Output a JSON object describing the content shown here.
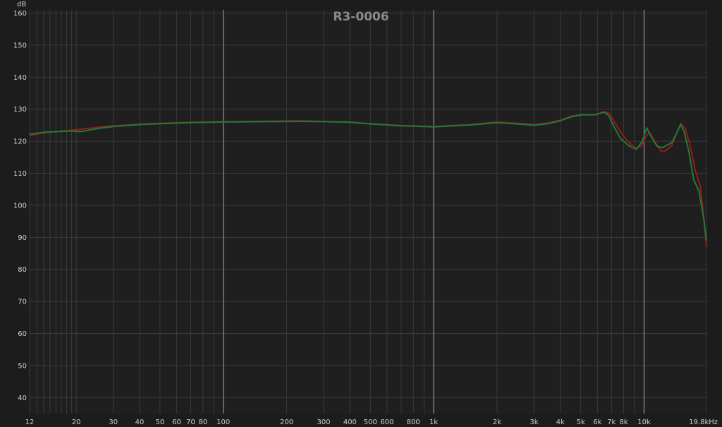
{
  "chart_data": {
    "type": "line",
    "title": "R3-0006",
    "ylabel": "dB",
    "xlabel": "",
    "x_scale": "log",
    "xlim": [
      12,
      19800
    ],
    "ylim": [
      35,
      161
    ],
    "grid": true,
    "y_ticks": [
      40,
      50,
      60,
      70,
      80,
      90,
      100,
      110,
      120,
      130,
      140,
      150,
      160
    ],
    "x_ticks": [
      {
        "v": 12,
        "label": "12"
      },
      {
        "v": 20,
        "label": "20"
      },
      {
        "v": 30,
        "label": "30"
      },
      {
        "v": 40,
        "label": "40"
      },
      {
        "v": 50,
        "label": "50"
      },
      {
        "v": 60,
        "label": "60"
      },
      {
        "v": 70,
        "label": "70"
      },
      {
        "v": 80,
        "label": "80"
      },
      {
        "v": 100,
        "label": "100"
      },
      {
        "v": 200,
        "label": "200"
      },
      {
        "v": 300,
        "label": "300"
      },
      {
        "v": 400,
        "label": "400"
      },
      {
        "v": 500,
        "label": "500"
      },
      {
        "v": 600,
        "label": "600"
      },
      {
        "v": 800,
        "label": "800"
      },
      {
        "v": 1000,
        "label": "1k"
      },
      {
        "v": 2000,
        "label": "2k"
      },
      {
        "v": 3000,
        "label": "3k"
      },
      {
        "v": 4000,
        "label": "4k"
      },
      {
        "v": 5000,
        "label": "5k"
      },
      {
        "v": 6000,
        "label": "6k"
      },
      {
        "v": 7000,
        "label": "7k"
      },
      {
        "v": 8000,
        "label": "8k"
      },
      {
        "v": 10000,
        "label": "10k"
      },
      {
        "v": 19800,
        "label": "19.8kHz"
      }
    ],
    "minor_grid_x": [
      12,
      13,
      14,
      15,
      16,
      17,
      18,
      19,
      20,
      30,
      40,
      50,
      60,
      70,
      80,
      90,
      200,
      300,
      400,
      500,
      600,
      700,
      800,
      900,
      2000,
      3000,
      4000,
      5000,
      6000,
      7000,
      8000,
      9000,
      19800
    ],
    "major_grid_x": [
      100,
      1000,
      10000
    ],
    "series": [
      {
        "color": "#9b1a16",
        "points": [
          [
            12,
            121.8
          ],
          [
            14,
            122.6
          ],
          [
            16,
            123.0
          ],
          [
            20,
            123.6
          ],
          [
            25,
            124.3
          ],
          [
            30,
            124.8
          ],
          [
            40,
            125.3
          ],
          [
            50,
            125.6
          ],
          [
            70,
            125.9
          ],
          [
            100,
            126.1
          ],
          [
            150,
            126.2
          ],
          [
            230,
            126.4
          ],
          [
            300,
            126.2
          ],
          [
            400,
            126.0
          ],
          [
            500,
            125.5
          ],
          [
            700,
            124.9
          ],
          [
            1000,
            124.6
          ],
          [
            1500,
            125.2
          ],
          [
            2000,
            126.0
          ],
          [
            2500,
            125.6
          ],
          [
            3000,
            125.2
          ],
          [
            3500,
            125.7
          ],
          [
            4000,
            126.6
          ],
          [
            4500,
            127.8
          ],
          [
            5000,
            128.3
          ],
          [
            5800,
            128.2
          ],
          [
            6500,
            129.3
          ],
          [
            6900,
            128.5
          ],
          [
            7300,
            125.5
          ],
          [
            7800,
            122.5
          ],
          [
            8500,
            119.5
          ],
          [
            9200,
            117.8
          ],
          [
            9700,
            118.5
          ],
          [
            10200,
            121.5
          ],
          [
            10600,
            122.8
          ],
          [
            11200,
            120.0
          ],
          [
            12000,
            117.0
          ],
          [
            12500,
            116.8
          ],
          [
            13500,
            118.5
          ],
          [
            14400,
            123.0
          ],
          [
            15000,
            125.5
          ],
          [
            15700,
            124.0
          ],
          [
            16500,
            119.0
          ],
          [
            17500,
            111.0
          ],
          [
            18500,
            106.0
          ],
          [
            19300,
            95.0
          ],
          [
            19800,
            87.0
          ]
        ]
      },
      {
        "color": "#1f7a3a",
        "points": [
          [
            12,
            122.2
          ],
          [
            14,
            122.8
          ],
          [
            16,
            123.0
          ],
          [
            19,
            123.2
          ],
          [
            21,
            123.0
          ],
          [
            25,
            123.9
          ],
          [
            30,
            124.6
          ],
          [
            40,
            125.2
          ],
          [
            50,
            125.5
          ],
          [
            70,
            125.8
          ],
          [
            100,
            126.0
          ],
          [
            150,
            126.1
          ],
          [
            230,
            126.2
          ],
          [
            300,
            126.1
          ],
          [
            400,
            125.9
          ],
          [
            500,
            125.4
          ],
          [
            700,
            124.8
          ],
          [
            1000,
            124.5
          ],
          [
            1500,
            125.1
          ],
          [
            2000,
            125.8
          ],
          [
            2500,
            125.4
          ],
          [
            3000,
            125.0
          ],
          [
            3500,
            125.5
          ],
          [
            4000,
            126.4
          ],
          [
            4500,
            127.6
          ],
          [
            5000,
            128.2
          ],
          [
            5800,
            128.3
          ],
          [
            6500,
            129.0
          ],
          [
            6800,
            128.0
          ],
          [
            7200,
            124.5
          ],
          [
            7700,
            121.0
          ],
          [
            8500,
            118.5
          ],
          [
            9200,
            117.5
          ],
          [
            9800,
            120.0
          ],
          [
            10300,
            124.2
          ],
          [
            10800,
            121.5
          ],
          [
            11500,
            118.5
          ],
          [
            12200,
            118.0
          ],
          [
            13500,
            119.5
          ],
          [
            14300,
            122.5
          ],
          [
            14900,
            125.3
          ],
          [
            15500,
            123.0
          ],
          [
            16300,
            117.0
          ],
          [
            17200,
            108.0
          ],
          [
            18200,
            104.5
          ],
          [
            19200,
            96.0
          ],
          [
            19800,
            89.0
          ]
        ]
      }
    ]
  }
}
